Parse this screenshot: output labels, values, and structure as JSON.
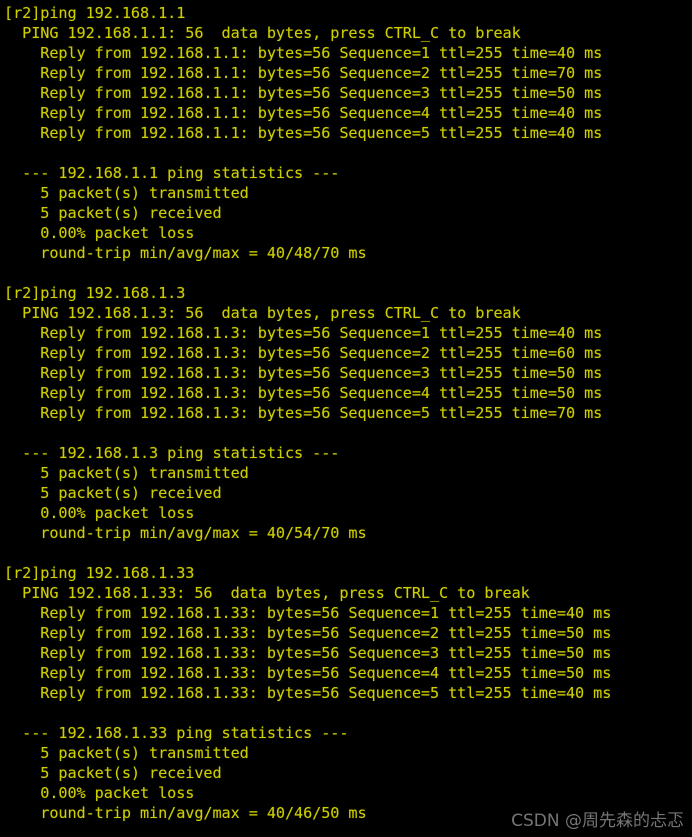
{
  "terminal": {
    "prompt": "[r2]",
    "background_color": "#000000",
    "text_color": "#cfcf00",
    "lines": [
      "[r2]ping 192.168.1.1",
      "  PING 192.168.1.1: 56  data bytes, press CTRL_C to break",
      "    Reply from 192.168.1.1: bytes=56 Sequence=1 ttl=255 time=40 ms",
      "    Reply from 192.168.1.1: bytes=56 Sequence=2 ttl=255 time=70 ms",
      "    Reply from 192.168.1.1: bytes=56 Sequence=3 ttl=255 time=50 ms",
      "    Reply from 192.168.1.1: bytes=56 Sequence=4 ttl=255 time=40 ms",
      "    Reply from 192.168.1.1: bytes=56 Sequence=5 ttl=255 time=40 ms",
      "",
      "  --- 192.168.1.1 ping statistics ---",
      "    5 packet(s) transmitted",
      "    5 packet(s) received",
      "    0.00% packet loss",
      "    round-trip min/avg/max = 40/48/70 ms",
      "",
      "[r2]ping 192.168.1.3",
      "  PING 192.168.1.3: 56  data bytes, press CTRL_C to break",
      "    Reply from 192.168.1.3: bytes=56 Sequence=1 ttl=255 time=40 ms",
      "    Reply from 192.168.1.3: bytes=56 Sequence=2 ttl=255 time=60 ms",
      "    Reply from 192.168.1.3: bytes=56 Sequence=3 ttl=255 time=50 ms",
      "    Reply from 192.168.1.3: bytes=56 Sequence=4 ttl=255 time=50 ms",
      "    Reply from 192.168.1.3: bytes=56 Sequence=5 ttl=255 time=70 ms",
      "",
      "  --- 192.168.1.3 ping statistics ---",
      "    5 packet(s) transmitted",
      "    5 packet(s) received",
      "    0.00% packet loss",
      "    round-trip min/avg/max = 40/54/70 ms",
      "",
      "[r2]ping 192.168.1.33",
      "  PING 192.168.1.33: 56  data bytes, press CTRL_C to break",
      "    Reply from 192.168.1.33: bytes=56 Sequence=1 ttl=255 time=40 ms",
      "    Reply from 192.168.1.33: bytes=56 Sequence=2 ttl=255 time=50 ms",
      "    Reply from 192.168.1.33: bytes=56 Sequence=3 ttl=255 time=50 ms",
      "    Reply from 192.168.1.33: bytes=56 Sequence=4 ttl=255 time=50 ms",
      "    Reply from 192.168.1.33: bytes=56 Sequence=5 ttl=255 time=40 ms",
      "",
      "  --- 192.168.1.33 ping statistics ---",
      "    5 packet(s) transmitted",
      "    5 packet(s) received",
      "    0.00% packet loss",
      "    round-trip min/avg/max = 40/46/50 ms"
    ],
    "sessions": [
      {
        "command": "ping 192.168.1.1",
        "target": "192.168.1.1",
        "data_bytes": 56,
        "replies": [
          {
            "sequence": 1,
            "bytes": 56,
            "ttl": 255,
            "time_ms": 40
          },
          {
            "sequence": 2,
            "bytes": 56,
            "ttl": 255,
            "time_ms": 70
          },
          {
            "sequence": 3,
            "bytes": 56,
            "ttl": 255,
            "time_ms": 50
          },
          {
            "sequence": 4,
            "bytes": 56,
            "ttl": 255,
            "time_ms": 40
          },
          {
            "sequence": 5,
            "bytes": 56,
            "ttl": 255,
            "time_ms": 40
          }
        ],
        "transmitted": 5,
        "received": 5,
        "packet_loss": "0.00%",
        "round_trip": "40/48/70 ms"
      },
      {
        "command": "ping 192.168.1.3",
        "target": "192.168.1.3",
        "data_bytes": 56,
        "replies": [
          {
            "sequence": 1,
            "bytes": 56,
            "ttl": 255,
            "time_ms": 40
          },
          {
            "sequence": 2,
            "bytes": 56,
            "ttl": 255,
            "time_ms": 60
          },
          {
            "sequence": 3,
            "bytes": 56,
            "ttl": 255,
            "time_ms": 50
          },
          {
            "sequence": 4,
            "bytes": 56,
            "ttl": 255,
            "time_ms": 50
          },
          {
            "sequence": 5,
            "bytes": 56,
            "ttl": 255,
            "time_ms": 70
          }
        ],
        "transmitted": 5,
        "received": 5,
        "packet_loss": "0.00%",
        "round_trip": "40/54/70 ms"
      },
      {
        "command": "ping 192.168.1.33",
        "target": "192.168.1.33",
        "data_bytes": 56,
        "replies": [
          {
            "sequence": 1,
            "bytes": 56,
            "ttl": 255,
            "time_ms": 40
          },
          {
            "sequence": 2,
            "bytes": 56,
            "ttl": 255,
            "time_ms": 50
          },
          {
            "sequence": 3,
            "bytes": 56,
            "ttl": 255,
            "time_ms": 50
          },
          {
            "sequence": 4,
            "bytes": 56,
            "ttl": 255,
            "time_ms": 50
          },
          {
            "sequence": 5,
            "bytes": 56,
            "ttl": 255,
            "time_ms": 40
          }
        ],
        "transmitted": 5,
        "received": 5,
        "packet_loss": "0.00%",
        "round_trip": "40/46/50 ms"
      }
    ]
  },
  "watermark": {
    "text": "CSDN @周先森的忐忑",
    "color": "#8a8a8a"
  }
}
